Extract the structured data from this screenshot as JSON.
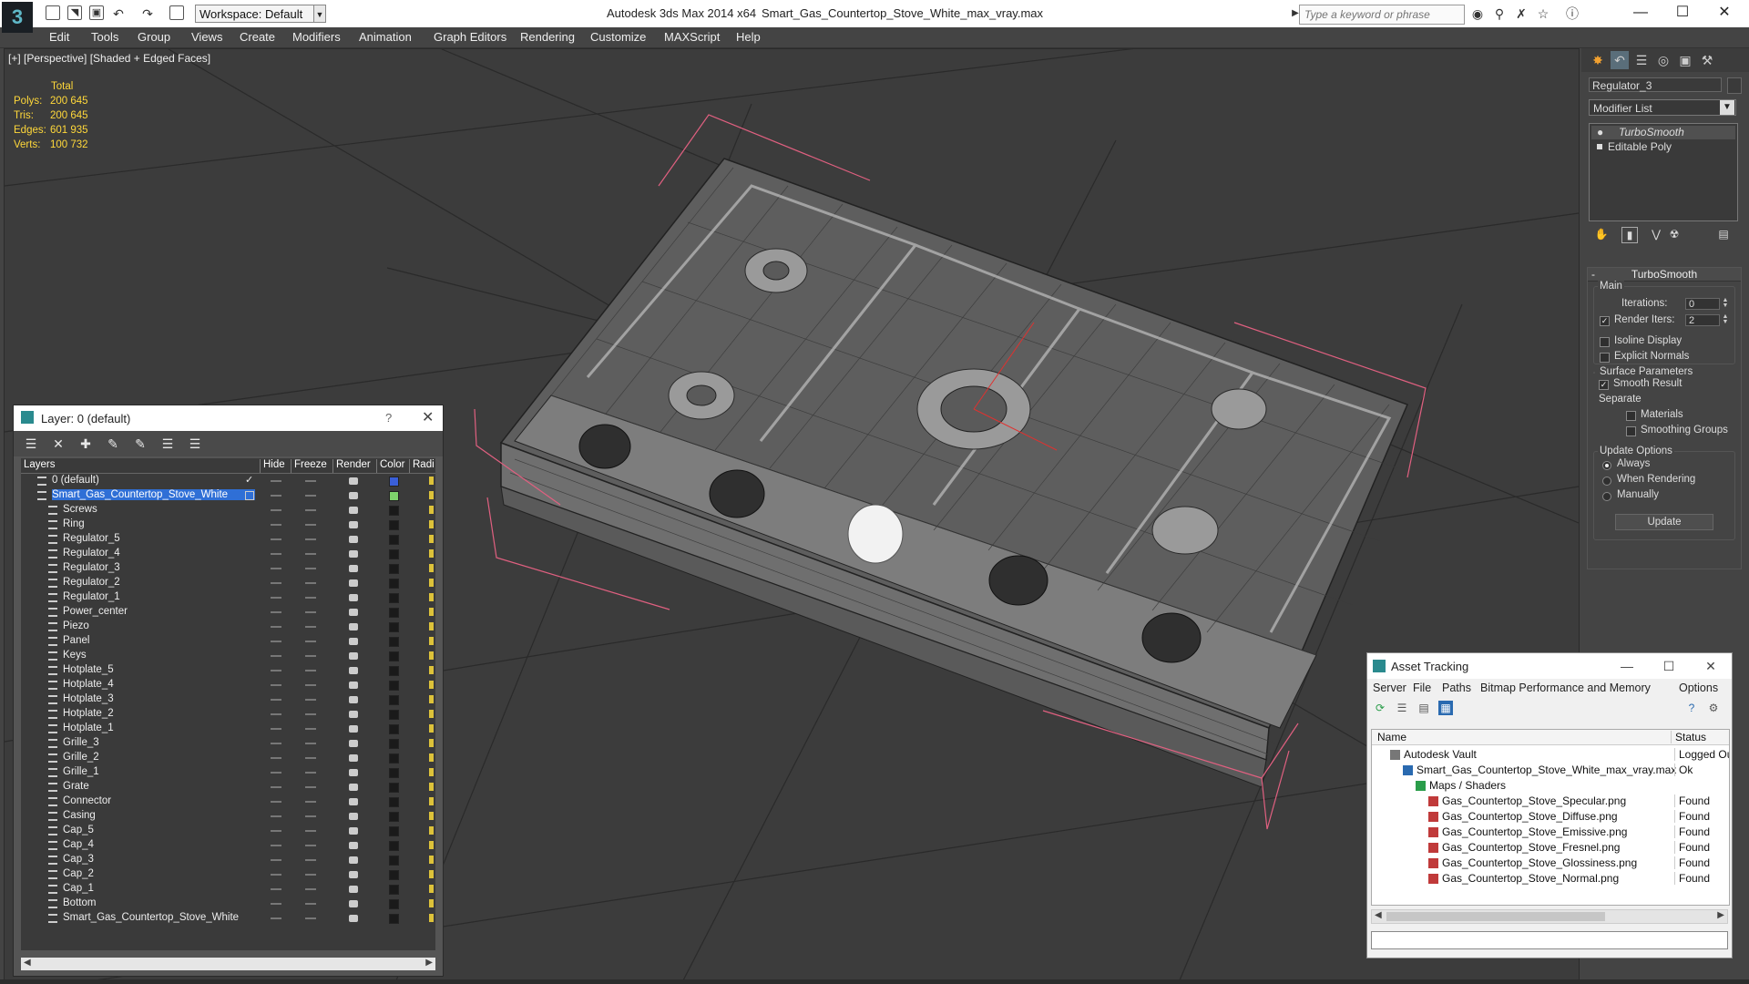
{
  "title_bar": {
    "app_title": "Autodesk 3ds Max  2014 x64",
    "document_title": "Smart_Gas_Countertop_Stove_White_max_vray.max",
    "workspace_label": "Workspace: Default",
    "search_placeholder": "Type a keyword or phrase"
  },
  "menu": [
    "Edit",
    "Tools",
    "Group",
    "Views",
    "Create",
    "Modifiers",
    "Animation",
    "Graph Editors",
    "Rendering",
    "Customize",
    "MAXScript",
    "Help"
  ],
  "viewport": {
    "label": "[+] [Perspective] [Shaded + Edged Faces]",
    "stats": {
      "header": "Total",
      "polys_label": "Polys:",
      "polys": "200 645",
      "tris_label": "Tris:",
      "tris": "200 645",
      "edges_label": "Edges:",
      "edges": "601 935",
      "verts_label": "Verts:",
      "verts": "100 732"
    }
  },
  "layer_dialog": {
    "title": "Layer: 0 (default)",
    "help": "?",
    "columns": {
      "layers": "Layers",
      "hide": "Hide",
      "freeze": "Freeze",
      "render": "Render",
      "color": "Color",
      "radiosity": "Radi"
    },
    "rows": [
      {
        "name": "0 (default)",
        "level": 0,
        "color": "#3a5fd8"
      },
      {
        "name": "Smart_Gas_Countertop_Stove_White",
        "level": 0,
        "color": "#7ed36c",
        "selected": true
      },
      {
        "name": "Screws",
        "level": 1,
        "color": "#1a1a1a"
      },
      {
        "name": "Ring",
        "level": 1,
        "color": "#1a1a1a"
      },
      {
        "name": "Regulator_5",
        "level": 1,
        "color": "#1a1a1a"
      },
      {
        "name": "Regulator_4",
        "level": 1,
        "color": "#1a1a1a"
      },
      {
        "name": "Regulator_3",
        "level": 1,
        "color": "#1a1a1a"
      },
      {
        "name": "Regulator_2",
        "level": 1,
        "color": "#1a1a1a"
      },
      {
        "name": "Regulator_1",
        "level": 1,
        "color": "#1a1a1a"
      },
      {
        "name": "Power_center",
        "level": 1,
        "color": "#1a1a1a"
      },
      {
        "name": "Piezo",
        "level": 1,
        "color": "#1a1a1a"
      },
      {
        "name": "Panel",
        "level": 1,
        "color": "#1a1a1a"
      },
      {
        "name": "Keys",
        "level": 1,
        "color": "#1a1a1a"
      },
      {
        "name": "Hotplate_5",
        "level": 1,
        "color": "#1a1a1a"
      },
      {
        "name": "Hotplate_4",
        "level": 1,
        "color": "#1a1a1a"
      },
      {
        "name": "Hotplate_3",
        "level": 1,
        "color": "#1a1a1a"
      },
      {
        "name": "Hotplate_2",
        "level": 1,
        "color": "#1a1a1a"
      },
      {
        "name": "Hotplate_1",
        "level": 1,
        "color": "#1a1a1a"
      },
      {
        "name": "Grille_3",
        "level": 1,
        "color": "#1a1a1a"
      },
      {
        "name": "Grille_2",
        "level": 1,
        "color": "#1a1a1a"
      },
      {
        "name": "Grille_1",
        "level": 1,
        "color": "#1a1a1a"
      },
      {
        "name": "Grate",
        "level": 1,
        "color": "#1a1a1a"
      },
      {
        "name": "Connector",
        "level": 1,
        "color": "#1a1a1a"
      },
      {
        "name": "Casing",
        "level": 1,
        "color": "#1a1a1a"
      },
      {
        "name": "Cap_5",
        "level": 1,
        "color": "#1a1a1a"
      },
      {
        "name": "Cap_4",
        "level": 1,
        "color": "#1a1a1a"
      },
      {
        "name": "Cap_3",
        "level": 1,
        "color": "#1a1a1a"
      },
      {
        "name": "Cap_2",
        "level": 1,
        "color": "#1a1a1a"
      },
      {
        "name": "Cap_1",
        "level": 1,
        "color": "#1a1a1a"
      },
      {
        "name": "Bottom",
        "level": 1,
        "color": "#1a1a1a"
      },
      {
        "name": "Smart_Gas_Countertop_Stove_White",
        "level": 1,
        "color": "#1a1a1a"
      }
    ]
  },
  "command_panel": {
    "object_name": "Regulator_3",
    "modifier_list": "Modifier List",
    "stack": [
      "TurboSmooth",
      "Editable Poly"
    ],
    "turbosmooth": {
      "title": "TurboSmooth",
      "main_label": "Main",
      "iterations_label": "Iterations:",
      "iterations": "0",
      "render_iters_label": "Render Iters:",
      "render_iters": "2",
      "isoline_label": "Isoline Display",
      "explicit_label": "Explicit Normals",
      "surface_label": "Surface Parameters",
      "smooth_result_label": "Smooth Result",
      "separate_label": "Separate",
      "materials_label": "Materials",
      "smoothing_groups_label": "Smoothing Groups",
      "update_options_label": "Update Options",
      "always_label": "Always",
      "when_rendering_label": "When Rendering",
      "manually_label": "Manually",
      "update_button": "Update"
    }
  },
  "asset_tracking": {
    "title": "Asset Tracking",
    "menu": [
      "Server",
      "File",
      "Paths",
      "Bitmap Performance and Memory",
      "Options"
    ],
    "columns": {
      "name": "Name",
      "status": "Status"
    },
    "rows": [
      {
        "name": "Autodesk Vault",
        "status": "Logged Ou",
        "level": 0,
        "icon": "vault"
      },
      {
        "name": "Smart_Gas_Countertop_Stove_White_max_vray.max",
        "status": "Ok",
        "level": 1,
        "icon": "max"
      },
      {
        "name": "Maps / Shaders",
        "status": "",
        "level": 2,
        "icon": "maps"
      },
      {
        "name": "Gas_Countertop_Stove_Specular.png",
        "status": "Found",
        "level": 3,
        "icon": "png"
      },
      {
        "name": "Gas_Countertop_Stove_Diffuse.png",
        "status": "Found",
        "level": 3,
        "icon": "png"
      },
      {
        "name": "Gas_Countertop_Stove_Emissive.png",
        "status": "Found",
        "level": 3,
        "icon": "png"
      },
      {
        "name": "Gas_Countertop_Stove_Fresnel.png",
        "status": "Found",
        "level": 3,
        "icon": "png"
      },
      {
        "name": "Gas_Countertop_Stove_Glossiness.png",
        "status": "Found",
        "level": 3,
        "icon": "png"
      },
      {
        "name": "Gas_Countertop_Stove_Normal.png",
        "status": "Found",
        "level": 3,
        "icon": "png"
      }
    ]
  }
}
